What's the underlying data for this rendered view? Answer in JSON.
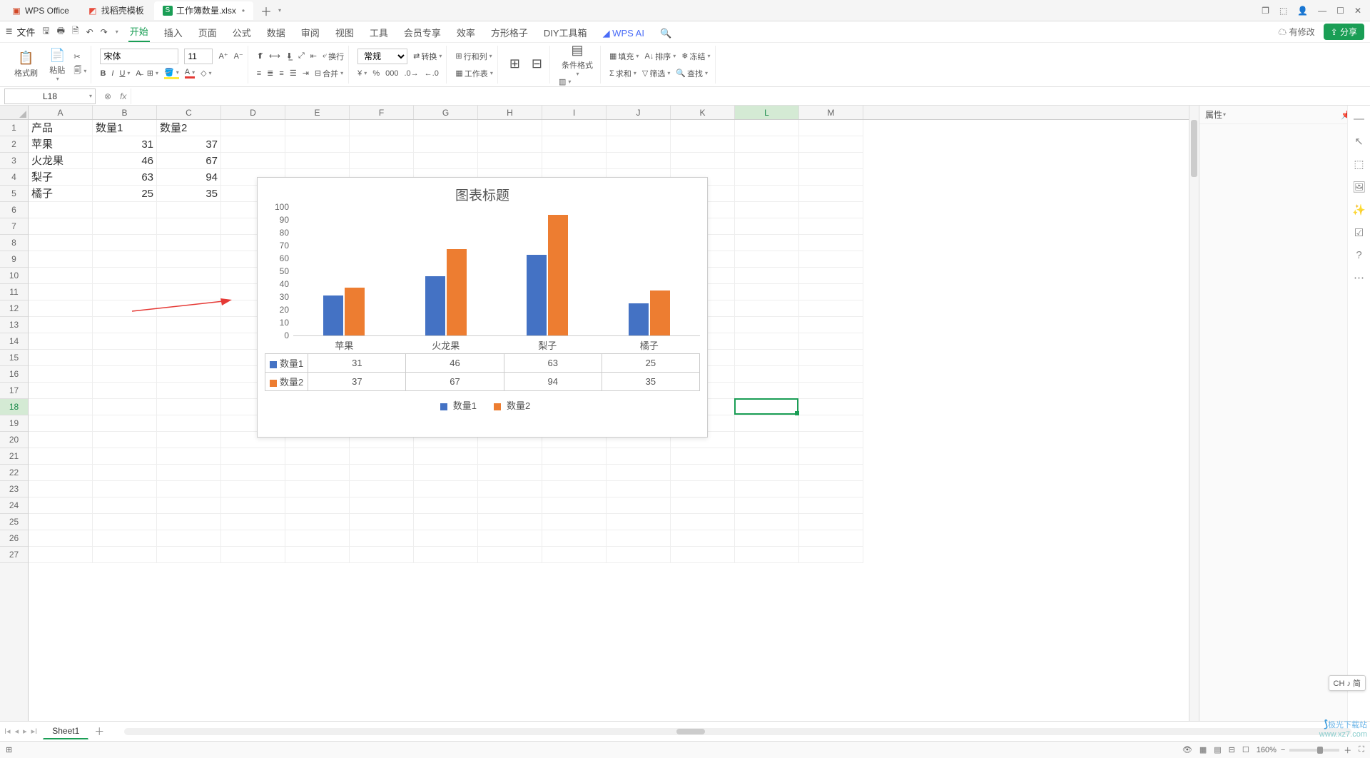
{
  "top_tabs": {
    "app": "WPS Office",
    "template": "找稻壳模板",
    "doc": "工作簿数量.xlsx"
  },
  "menu": {
    "file": "文件",
    "items": [
      "开始",
      "插入",
      "页面",
      "公式",
      "数据",
      "审阅",
      "视图",
      "工具",
      "会员专享",
      "效率",
      "方形格子",
      "DIY工具箱"
    ],
    "ai": "WPS AI",
    "modify": "有修改",
    "share": "分享"
  },
  "ribbon": {
    "fmt_painter": "格式刷",
    "paste": "粘贴",
    "font": "宋体",
    "size": "11",
    "general": "常规",
    "convert": "转换",
    "rowcol": "行和列",
    "worksheet": "工作表",
    "cond_fmt": "条件格式",
    "fill": "填充",
    "sort": "排序",
    "freeze": "冻结",
    "sum": "求和",
    "filter": "筛选",
    "find": "查找",
    "wrap": "换行",
    "merge": "合并"
  },
  "namebox": "L18",
  "columns": [
    "A",
    "B",
    "C",
    "D",
    "E",
    "F",
    "G",
    "H",
    "I",
    "J",
    "K",
    "L",
    "M"
  ],
  "row_count": 27,
  "sel": {
    "col": 11,
    "row": 18
  },
  "cells": {
    "A1": "产品",
    "B1": "数量1",
    "C1": "数量2",
    "A2": "苹果",
    "B2": "31",
    "C2": "37",
    "A3": "火龙果",
    "B3": "46",
    "C3": "67",
    "A4": "梨子",
    "B4": "63",
    "C4": "94",
    "A5": "橘子",
    "B5": "25",
    "C5": "35"
  },
  "chart_data": {
    "type": "bar",
    "title": "图表标题",
    "categories": [
      "苹果",
      "火龙果",
      "梨子",
      "橘子"
    ],
    "series": [
      {
        "name": "数量1",
        "values": [
          31,
          46,
          63,
          25
        ],
        "color": "#4472c4"
      },
      {
        "name": "数量2",
        "values": [
          37,
          67,
          94,
          35
        ],
        "color": "#ed7d31"
      }
    ],
    "ylim": [
      0,
      100
    ],
    "ytick": 10,
    "xlabel": "",
    "ylabel": ""
  },
  "sheet": {
    "name": "Sheet1"
  },
  "status": {
    "zoom": "160%",
    "ime": "CH ♪ 简"
  },
  "panel": {
    "title": "属性"
  },
  "watermark": {
    "l1": "极光下载站",
    "l2": "www.xz7.com"
  }
}
